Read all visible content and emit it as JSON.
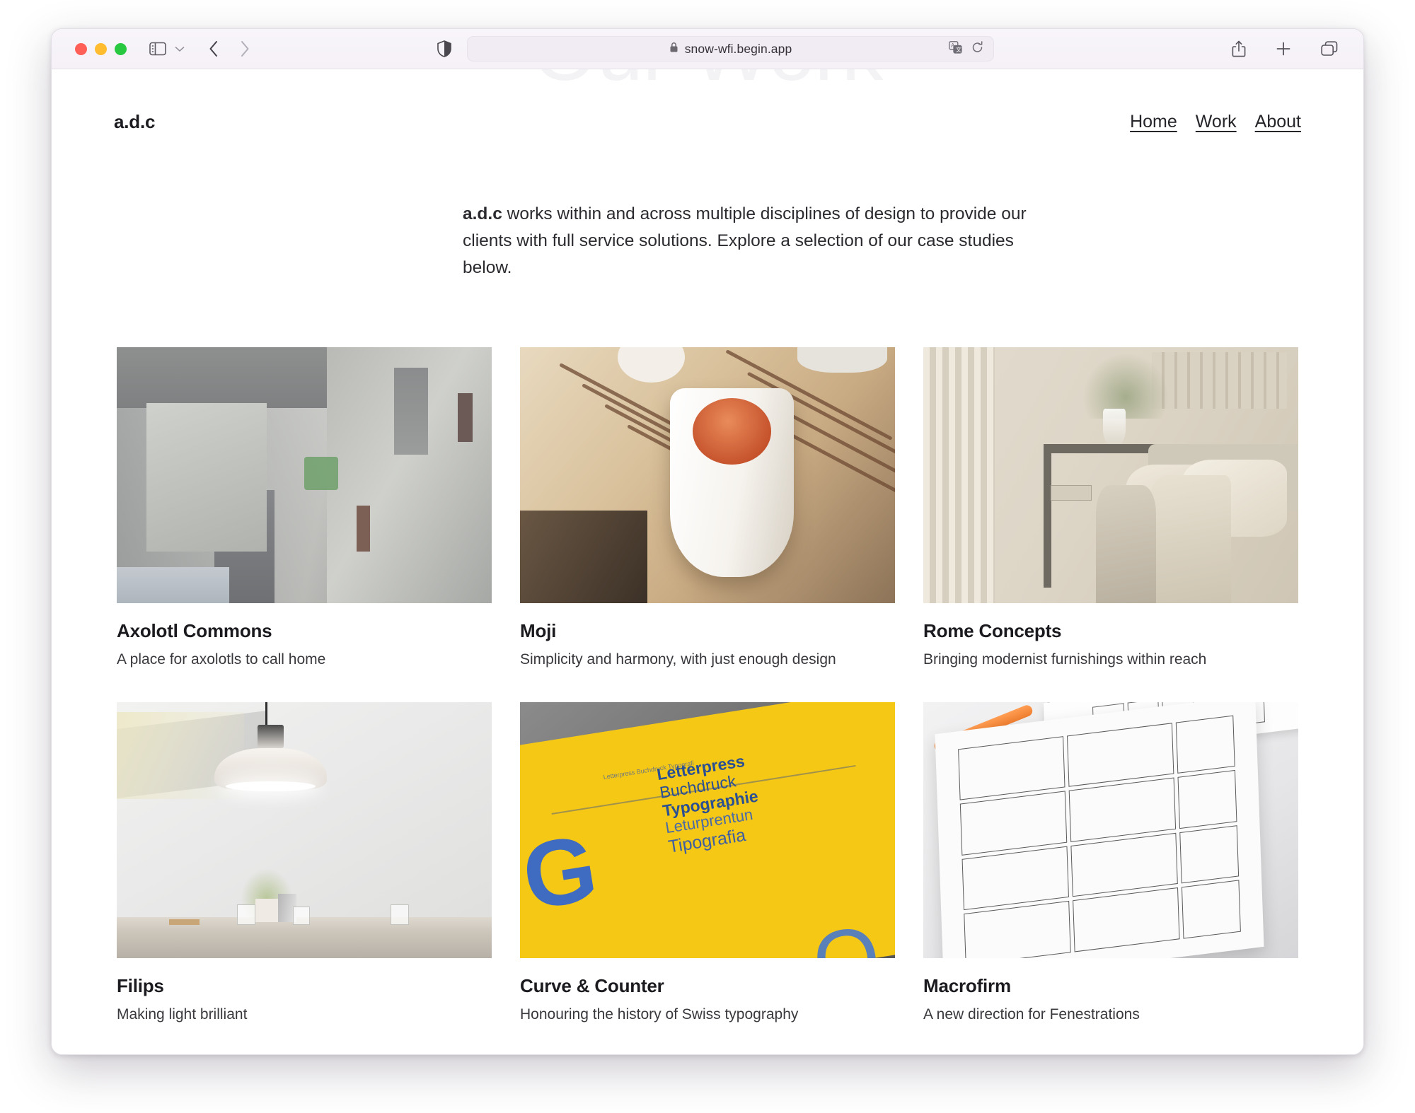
{
  "browser": {
    "name": "safari",
    "url": "snow-wfi.begin.app",
    "lock_icon": "lock-icon",
    "translate_icon": "translate-icon",
    "reload_icon": "reload-icon",
    "sidebar_icon": "sidebar-icon",
    "tab_overview_icon": "tab-overview-icon",
    "share_icon": "share-icon",
    "new_tab_icon": "plus-icon",
    "back_icon": "chevron-left-icon",
    "forward_icon": "chevron-right-icon",
    "shield_icon": "privacy-shield-icon",
    "traffic_lights": [
      "close",
      "minimize",
      "zoom"
    ]
  },
  "page": {
    "ghost_heading": "Our Work",
    "logo": "a.d.c",
    "nav": [
      {
        "label": "Home"
      },
      {
        "label": "Work"
      },
      {
        "label": "About"
      }
    ],
    "intro": {
      "lead": "a.d.c",
      "body": " works within and across multiple disciplines of design to provide our clients with full service solutions. Explore a selection of our case studies below."
    },
    "projects": [
      {
        "title": "Axolotl Commons",
        "description": "A place for axolotls to call home",
        "image_alt": "concrete-brutalist-courtyard"
      },
      {
        "title": "Moji",
        "description": "Simplicity and harmony, with just enough design",
        "image_alt": "white-cup-of-tea-on-wooden-tray"
      },
      {
        "title": "Rome Concepts",
        "description": "Bringing modernist furnishings within reach",
        "image_alt": "beige-bedroom-interior-with-linen"
      },
      {
        "title": "Filips",
        "description": "Making light brilliant",
        "image_alt": "white-pendant-lamp-above-counter"
      },
      {
        "title": "Curve & Counter",
        "description": "Honouring the history of Swiss typography",
        "image_alt": "yellow-typography-poster"
      },
      {
        "title": "Macrofirm",
        "description": "A new direction for Fenestrations",
        "image_alt": "hand-drawn-wireframe-sketches"
      }
    ],
    "poster_artwork": {
      "line1": "Letterpress",
      "line2": "Buchdruck",
      "line3": "Typographie",
      "line4": "Leturprentun",
      "line5": "Tipografia",
      "glyph_g": "G",
      "glyph_q": "Q",
      "caption": "Letterpress\nBuchdruck\nTypografi"
    }
  },
  "colors": {
    "page_background": "#ffffff",
    "text_primary": "#1b1a1e",
    "text_secondary": "#3a383d",
    "ghost_heading": "#f3f2f4",
    "toolbar_background": "#f5f1f7",
    "urlbar_background": "#f1ecf4",
    "poster_yellow": "#f5c816",
    "poster_blue": "#2a4f93",
    "marker_orange": "#ef7f30"
  }
}
